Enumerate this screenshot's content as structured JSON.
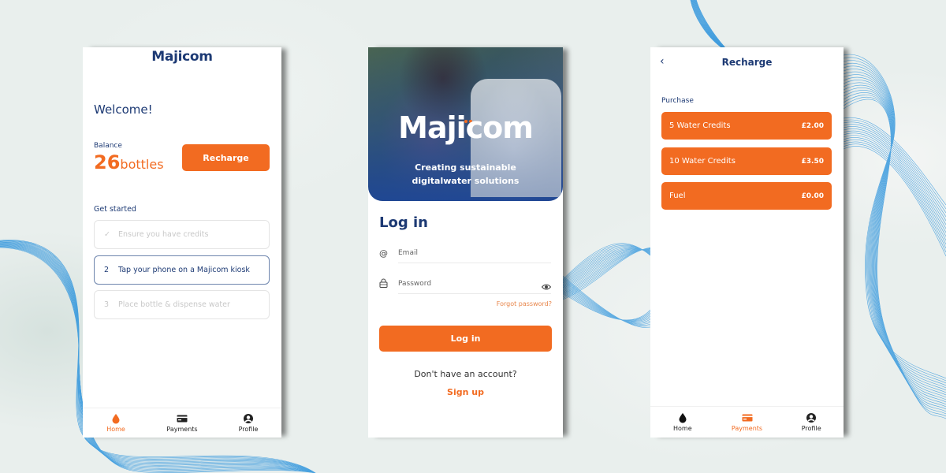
{
  "brand": {
    "name": "Majicom",
    "accent_color": "#f26b21",
    "primary_color": "#1d3a74"
  },
  "home_screen": {
    "logo": "Majicom",
    "welcome": "Welcome!",
    "balance_label": "Balance",
    "balance_value": "26",
    "balance_unit": "bottles",
    "recharge_button": "Recharge",
    "get_started_label": "Get started",
    "steps": [
      {
        "marker": "✓",
        "label": "Ensure you have credits",
        "state": "completed"
      },
      {
        "marker": "2",
        "label": "Tap your phone on a Majicom kiosk",
        "state": "active"
      },
      {
        "marker": "3",
        "label": "Place bottle & dispense water",
        "state": "pending"
      }
    ],
    "nav": [
      {
        "icon": "drop-icon",
        "label": "Home",
        "active": true
      },
      {
        "icon": "card-icon",
        "label": "Payments",
        "active": false
      },
      {
        "icon": "profile-icon",
        "label": "Profile",
        "active": false
      }
    ]
  },
  "login_screen": {
    "hero_logo": "Majicom",
    "tagline_line1": "Creating sustainable",
    "tagline_line2": "digitalwater solutions",
    "title": "Log in",
    "email_placeholder": "Email",
    "password_placeholder": "Password",
    "forgot_password": "Forgot password?",
    "login_button": "Log in",
    "no_account": "Don't have an account?",
    "sign_up": "Sign up"
  },
  "recharge_screen": {
    "back": "‹",
    "title": "Recharge",
    "purchase_label": "Purchase",
    "options": [
      {
        "label": "5 Water Credits",
        "price": "£2.00"
      },
      {
        "label": "10 Water Credits",
        "price": "£3.50"
      },
      {
        "label": "Fuel",
        "price": "£0.00"
      }
    ],
    "nav": [
      {
        "icon": "drop-icon",
        "label": "Home",
        "active": false
      },
      {
        "icon": "card-icon",
        "label": "Payments",
        "active": true
      },
      {
        "icon": "profile-icon",
        "label": "Profile",
        "active": false
      }
    ]
  }
}
